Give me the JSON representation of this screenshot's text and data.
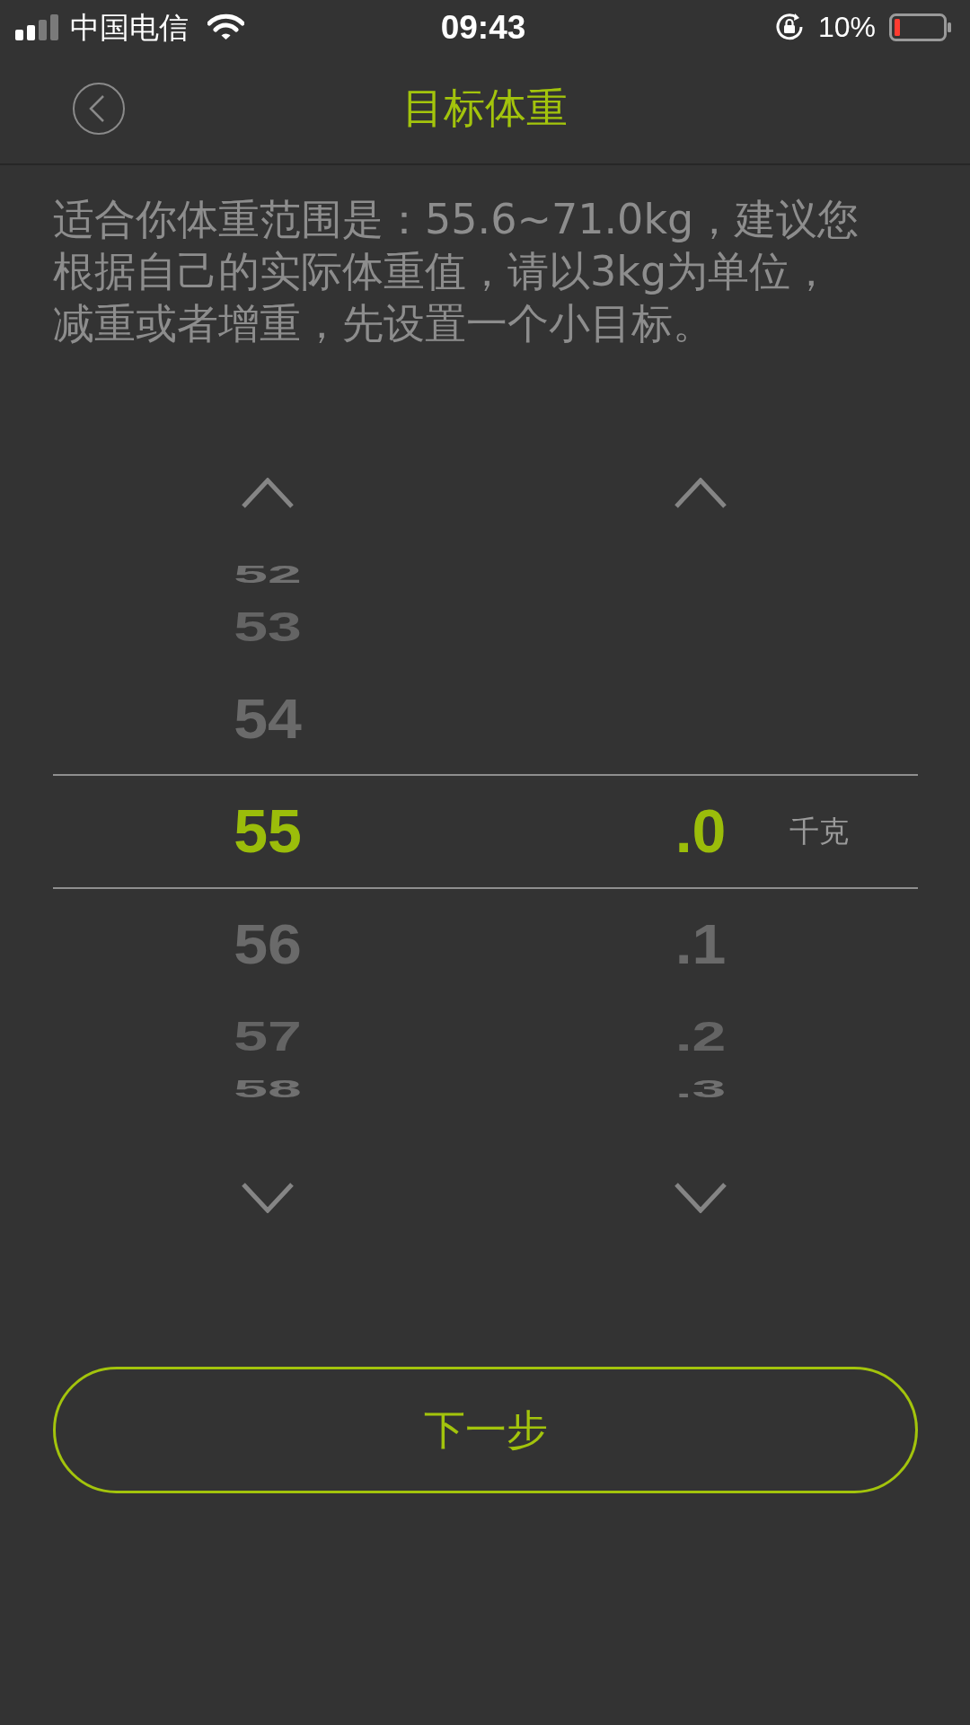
{
  "status_bar": {
    "carrier": "中国电信",
    "time": "09:43",
    "battery": "10%"
  },
  "header": {
    "title": "目标体重"
  },
  "description": "适合你体重范围是：55.6~71.0kg，建议您根据自己的实际体重值，请以3kg为单位，减重或者增重，先设置一个小目标。",
  "picker": {
    "columns": [
      {
        "items": [
          {
            "label": "52",
            "selected": false
          },
          {
            "label": "53",
            "selected": false
          },
          {
            "label": "54",
            "selected": false
          },
          {
            "label": "55",
            "selected": true
          },
          {
            "label": "56",
            "selected": false
          },
          {
            "label": "57",
            "selected": false
          },
          {
            "label": "58",
            "selected": false
          }
        ]
      },
      {
        "items": [
          {
            "label": ".0",
            "selected": true
          },
          {
            "label": ".1",
            "selected": false
          },
          {
            "label": ".2",
            "selected": false
          },
          {
            "label": ".3",
            "selected": false
          }
        ]
      }
    ],
    "unit": "千克"
  },
  "next_button": {
    "label": "下一步"
  }
}
